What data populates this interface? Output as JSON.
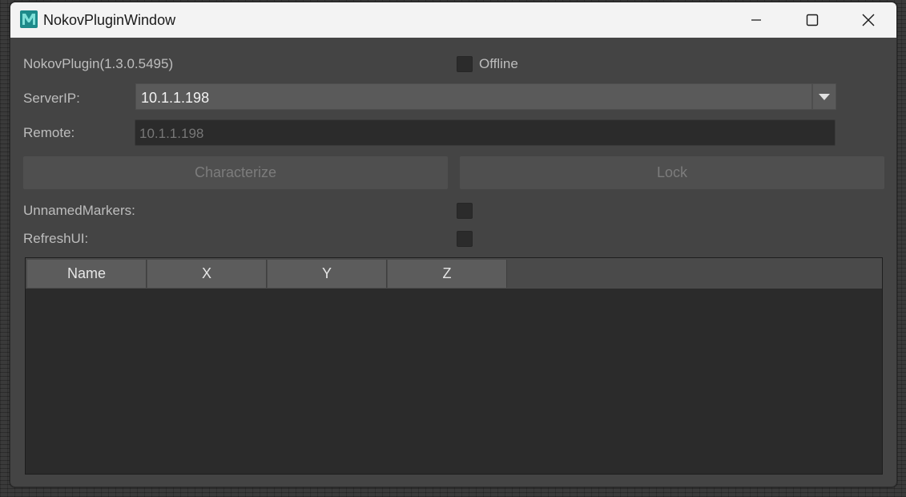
{
  "window": {
    "title": "NokovPluginWindow",
    "icon": "maya-app-icon"
  },
  "plugin": {
    "version_label": "NokovPlugin(1.3.0.5495)",
    "offline_label": "Offline",
    "offline_checked": false
  },
  "server": {
    "label": "ServerIP:",
    "value": "10.1.1.198"
  },
  "remote": {
    "label": "Remote:",
    "placeholder": "10.1.1.198"
  },
  "buttons": {
    "characterize": "Characterize",
    "lock": "Lock"
  },
  "options": {
    "unnamed_markers_label": "UnnamedMarkers:",
    "refresh_ui_label": "RefreshUI:"
  },
  "table": {
    "columns": [
      "Name",
      "X",
      "Y",
      "Z"
    ],
    "rows": []
  },
  "colors": {
    "window_bg": "#444444",
    "titlebar_bg": "#f3f3f3",
    "field_bg": "#2b2b2b",
    "combo_bg": "#5a5a5a"
  }
}
